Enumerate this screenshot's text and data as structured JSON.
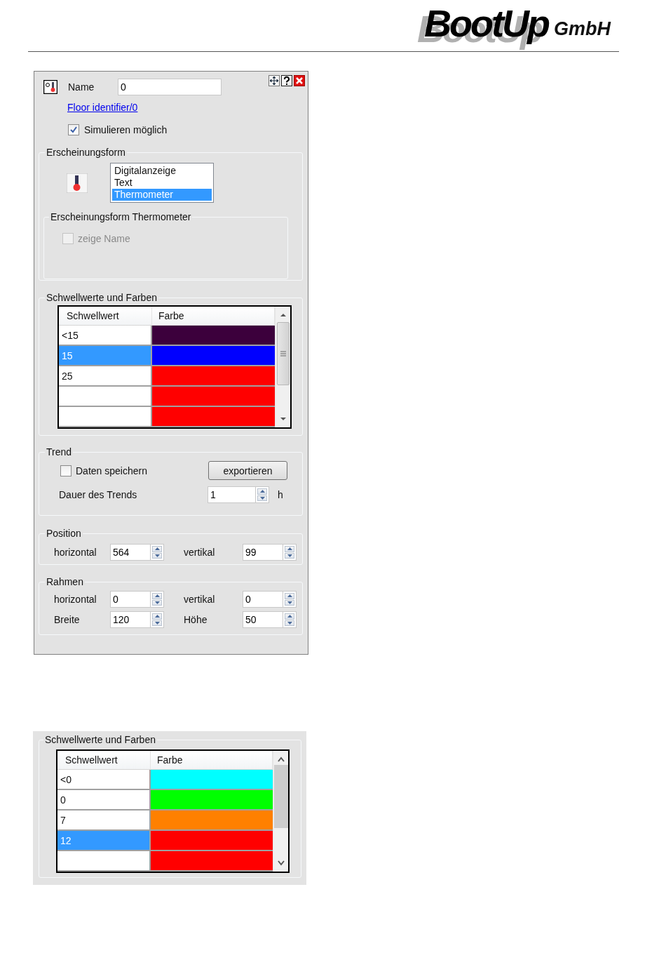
{
  "header": {
    "brand": "BootUp",
    "suffix": "GmbH"
  },
  "dialog": {
    "name_label": "Name",
    "name_value": "0",
    "link": "Floor identifier/0",
    "simulate": {
      "label": "Simulieren möglich",
      "checked": true
    },
    "appearance": {
      "title": "Erscheinungsform",
      "options": [
        {
          "label": "Digitalanzeige",
          "selected": false
        },
        {
          "label": "Text",
          "selected": false
        },
        {
          "label": "Thermometer",
          "selected": true
        }
      ],
      "sub": {
        "title": "Erscheinungsform Thermometer",
        "show_name": {
          "label": "zeige Name",
          "checked": false,
          "disabled": true
        }
      }
    },
    "thresholds": {
      "title": "Schwellwerte und Farben",
      "columns": [
        "Schwellwert",
        "Farbe"
      ],
      "rows": [
        {
          "value": "<15",
          "color": "#3c003c",
          "selected": false
        },
        {
          "value": "15",
          "color": "#0000ff",
          "selected": true
        },
        {
          "value": "25",
          "color": "#ff0000",
          "selected": false
        },
        {
          "color": "#ff0000",
          "selected": false
        },
        {
          "color": "#ff0000",
          "selected": false
        }
      ]
    },
    "trend": {
      "title": "Trend",
      "save": {
        "label": "Daten speichern",
        "checked": false
      },
      "export_button": "exportieren",
      "duration_label": "Dauer des Trends",
      "duration_value": "1",
      "unit": "h"
    },
    "position": {
      "title": "Position",
      "rows": [
        [
          {
            "label": "horizontal",
            "value": "564"
          },
          {
            "label": "vertikal",
            "value": "99"
          }
        ]
      ]
    },
    "frame": {
      "title": "Rahmen",
      "rows": [
        [
          {
            "label": "horizontal",
            "value": "0"
          },
          {
            "label": "vertikal",
            "value": "0"
          }
        ],
        [
          {
            "label": "Breite",
            "value": "120"
          },
          {
            "label": "Höhe",
            "value": "50"
          }
        ]
      ]
    }
  },
  "example": {
    "title": "Schwellwerte und Farben",
    "columns": [
      "Schwellwert",
      "Farbe"
    ],
    "rows": [
      {
        "value": "<0",
        "color": "#00ffff",
        "selected": false
      },
      {
        "value": "0",
        "color": "#00ff00",
        "selected": false
      },
      {
        "value": "7",
        "color": "#ff8000",
        "selected": false
      },
      {
        "value": "12",
        "color": "#ff0000",
        "selected": true
      },
      {
        "color": "#ff0000",
        "selected": false
      }
    ]
  }
}
